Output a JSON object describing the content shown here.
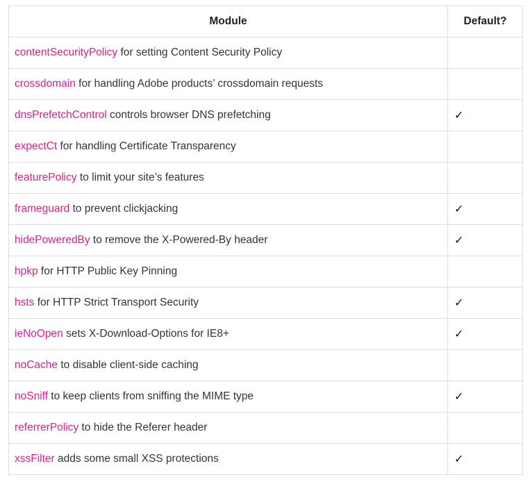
{
  "table": {
    "headers": {
      "module": "Module",
      "default": "Default?"
    },
    "check_mark": "✓",
    "rows": [
      {
        "name": "contentSecurityPolicy",
        "desc": " for setting Content Security Policy",
        "default": ""
      },
      {
        "name": "crossdomain",
        "desc": " for handling Adobe products’ crossdomain requests",
        "default": ""
      },
      {
        "name": "dnsPrefetchControl",
        "desc": " controls browser DNS prefetching",
        "default": "✓"
      },
      {
        "name": "expectCt",
        "desc": " for handling Certificate Transparency",
        "default": ""
      },
      {
        "name": "featurePolicy",
        "desc": " to limit your site’s features",
        "default": ""
      },
      {
        "name": "frameguard",
        "desc": " to prevent clickjacking",
        "default": "✓"
      },
      {
        "name": "hidePoweredBy",
        "desc": " to remove the X-Powered-By header",
        "default": "✓"
      },
      {
        "name": "hpkp",
        "desc": " for HTTP Public Key Pinning",
        "default": ""
      },
      {
        "name": "hsts",
        "desc": " for HTTP Strict Transport Security",
        "default": "✓"
      },
      {
        "name": "ieNoOpen",
        "desc": " sets X-Download-Options for IE8+",
        "default": "✓"
      },
      {
        "name": "noCache",
        "desc": " to disable client-side caching",
        "default": ""
      },
      {
        "name": "noSniff",
        "desc": " to keep clients from sniffing the MIME type",
        "default": "✓"
      },
      {
        "name": "referrerPolicy",
        "desc": " to hide the Referer header",
        "default": ""
      },
      {
        "name": "xssFilter",
        "desc": " adds some small XSS protections",
        "default": "✓"
      }
    ]
  },
  "colors": {
    "module_link": "#e01e8c",
    "border": "#dddddd",
    "text": "#333333"
  }
}
